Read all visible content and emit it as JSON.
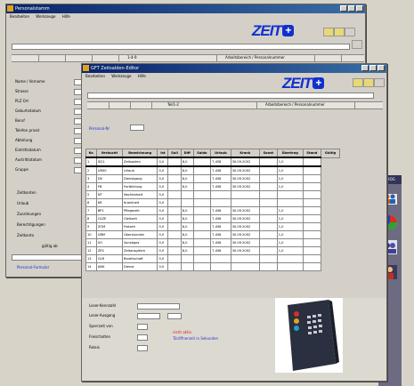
{
  "window_back": {
    "title": "Personalstamm",
    "menu": [
      "Bearbeiten",
      "Werkzeuge",
      "Hilfe"
    ],
    "logo": "ZEIT",
    "tab_labels": [
      "1-4-9",
      "Arbeitsbereich / Personalnummer"
    ],
    "form_labels": [
      "Name / Vorname",
      "Strasse",
      "PLZ Ort",
      "Geburtsdatum",
      "Beruf",
      "Telefon privat",
      "Abteilung",
      "Eintrittsdatum",
      "Austrittsdatum",
      "Gruppe"
    ],
    "side_items": [
      "Zeitkonten",
      "Urlaub",
      "Zuordnungen",
      "Berechtigungen",
      "Zeitkonto",
      "gültig ab"
    ],
    "footer_link": "Personal-Formular"
  },
  "window_front": {
    "title": "GFT Zeitsalden-Editor",
    "menu": [
      "Bearbeiten",
      "Werkzeuge",
      "Hilfe"
    ],
    "logo": "ZEIT",
    "tab_labels": [
      "Teil1-2",
      "Arbeitsbereich / Personalnummer"
    ],
    "filter_label": "Personal-Nr",
    "table": {
      "headers": [
        "Nr.",
        "Verbucht",
        "Bezeichnung",
        "Ist",
        "Soll",
        "Diff",
        "Saldo",
        "Urlaub",
        "Krank",
        "Sonst",
        "Übertrag",
        "Stand",
        "Gültig"
      ],
      "rows": [
        [
          "1",
          "IS21",
          "Zeitsalden",
          "0,0",
          "",
          "8,0",
          "",
          "7,458",
          "30.09.2002",
          "",
          "1,0",
          ""
        ],
        [
          "2",
          "UR00",
          "Urlaub",
          "0,0",
          "",
          "8,0",
          "",
          "7,458",
          "30.09.2002",
          "",
          "1,0",
          ""
        ],
        [
          "3",
          "DE",
          "Dienstgang",
          "0,0",
          "",
          "8,0",
          "",
          "7,458",
          "30.09.2002",
          "",
          "1,0",
          ""
        ],
        [
          "4",
          "FB",
          "Fortbildung",
          "0,0",
          "",
          "8,0",
          "",
          "7,458",
          "30.09.2002",
          "",
          "1,0",
          ""
        ],
        [
          "5",
          "NT",
          "Nachtarbeit",
          "0,0",
          "",
          "",
          "",
          "",
          "",
          "",
          "",
          ""
        ],
        [
          "6",
          "KR",
          "Krankheit",
          "0,0",
          "",
          "",
          "",
          "",
          "",
          "",
          "",
          ""
        ],
        [
          "7",
          "BP1",
          "Pflegezeit",
          "0,0",
          "",
          "8,0",
          "",
          "7,458",
          "30.09.2002",
          "",
          "1,0",
          ""
        ],
        [
          "8",
          "GLZE",
          "Gleitzeit",
          "0,0",
          "",
          "8,0",
          "",
          "7,458",
          "30.09.2002",
          "",
          "1,0",
          ""
        ],
        [
          "9",
          "ZOM",
          "Freizeit",
          "0,0",
          "",
          "8,0",
          "",
          "7,458",
          "30.09.2002",
          "",
          "1,0",
          ""
        ],
        [
          "10",
          "UBM",
          "Überstunden",
          "0,0",
          "",
          "8,0",
          "",
          "7,458",
          "30.09.2002",
          "",
          "1,0",
          ""
        ],
        [
          "11",
          "SO",
          "Sonstiges",
          "0,0",
          "",
          "8,0",
          "",
          "7,458",
          "30.09.2002",
          "",
          "1,0",
          ""
        ],
        [
          "12",
          "ZES",
          "Zeitausgleich",
          "0,0",
          "",
          "8,0",
          "",
          "7,458",
          "30.09.2002",
          "",
          "1,0",
          ""
        ],
        [
          "13",
          "GLR",
          "Bereitschaft",
          "0,0",
          "",
          "",
          "",
          "",
          "",
          "",
          "",
          ""
        ],
        [
          "14",
          "ANK",
          "Dienst",
          "0,0",
          "",
          "",
          "",
          "",
          "",
          "",
          "",
          ""
        ]
      ]
    },
    "bottom_labels": [
      "Leser-Kennzahl",
      "Leser-Ausgang",
      "Sperrzeit von",
      "Freischalten",
      "Relais"
    ],
    "red_text": "nicht aktiv",
    "blue_text": "Türöffnerzeit in Sekunden"
  },
  "sidebar": {
    "head": "PROG"
  },
  "colors": {
    "logo": "#1030d0",
    "titlebar": "#0a246a",
    "sidebar": "#6d6b82"
  }
}
